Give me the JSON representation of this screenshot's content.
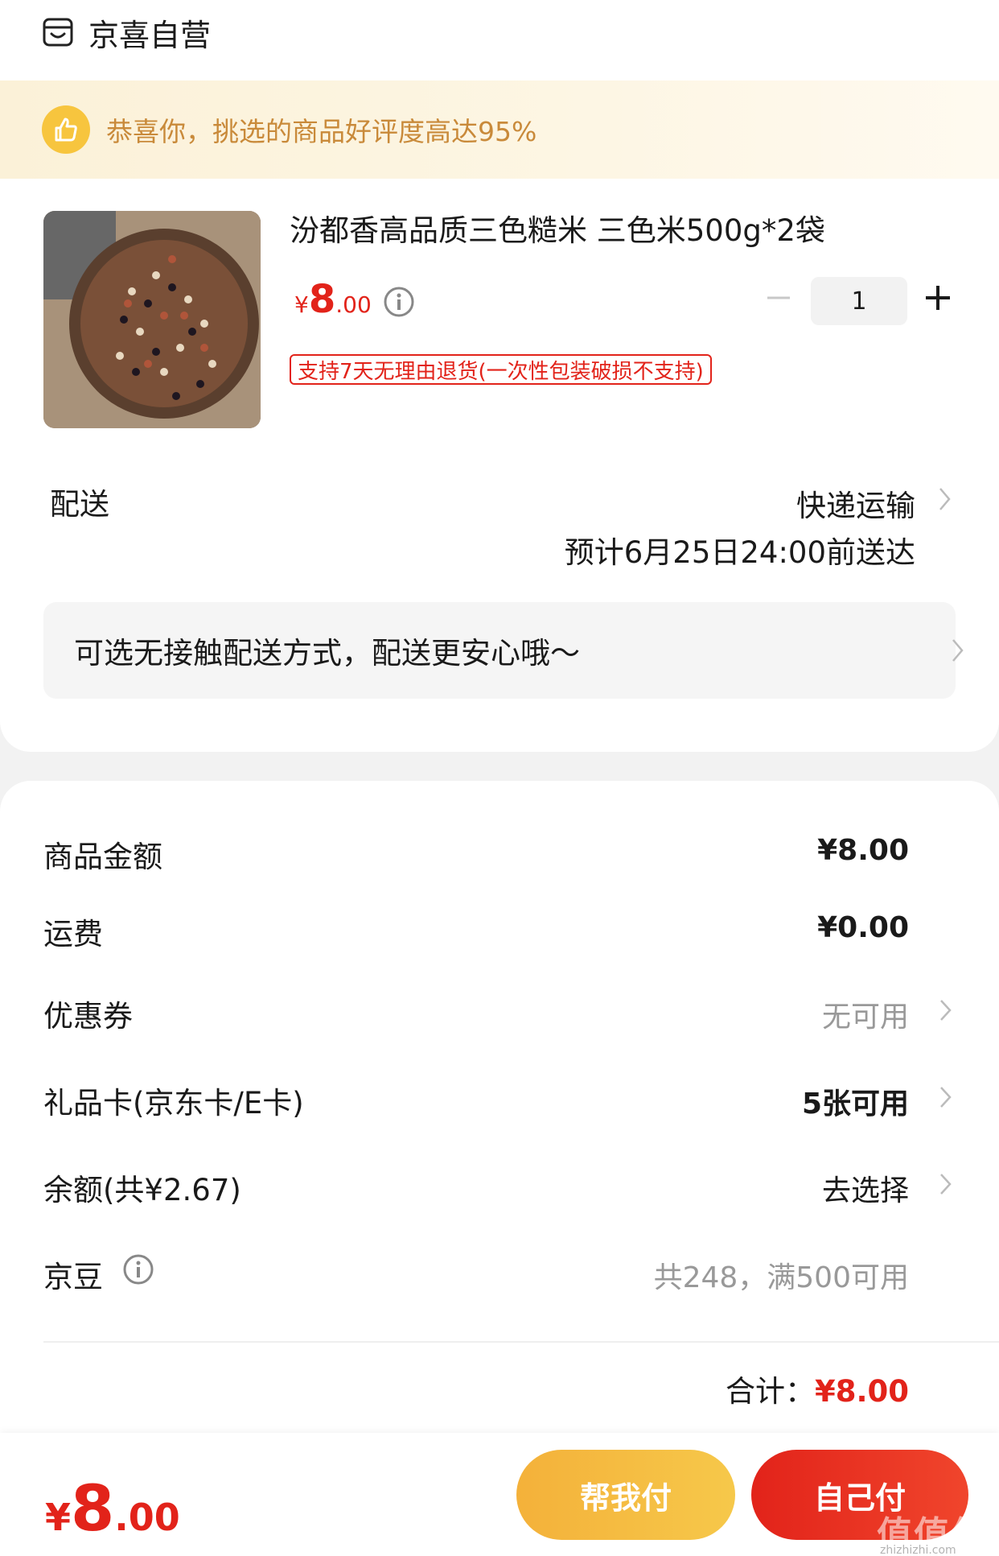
{
  "shop": {
    "name": "京喜自营",
    "icon": "shop-icon"
  },
  "praise": {
    "text": "恭喜你，挑选的商品好评度高达95%",
    "icon": "thumbs-up-icon"
  },
  "product": {
    "title": "汾都香高品质三色糙米 三色米500g*2袋",
    "price_symbol": "¥",
    "price_int": "8",
    "price_dec": ".00",
    "quantity": "1",
    "return_policy": "支持7天无理由退货(一次性包装破损不支持)"
  },
  "shipping": {
    "label": "配送",
    "method": "快递运输",
    "eta": "预计6月25日24:00前送达",
    "contactless": "可选无接触配送方式，配送更安心哦～"
  },
  "summary": {
    "goods_label": "商品金额",
    "goods_value": "¥8.00",
    "freight_label": "运费",
    "freight_value": "¥0.00",
    "coupon_label": "优惠券",
    "coupon_value": "无可用",
    "giftcard_label": "礼品卡(京东卡/E卡)",
    "giftcard_value": "5张可用",
    "balance_label": "余额(共¥2.67)",
    "balance_value": "去选择",
    "jingdou_label": "京豆",
    "jingdou_value": "共248，满500可用",
    "total_label": "合计：",
    "total_value": "¥8.00"
  },
  "footer": {
    "price_symbol": "¥",
    "price_int": "8",
    "price_dec": ".00",
    "help_pay": "帮我付",
    "self_pay": "自己付",
    "watermark": "值值值",
    "watermark_sub": "zhizhizhi.com"
  },
  "colors": {
    "accent": "#e2231a",
    "gold": "#f4b13a",
    "praise_text": "#c98a3a"
  }
}
